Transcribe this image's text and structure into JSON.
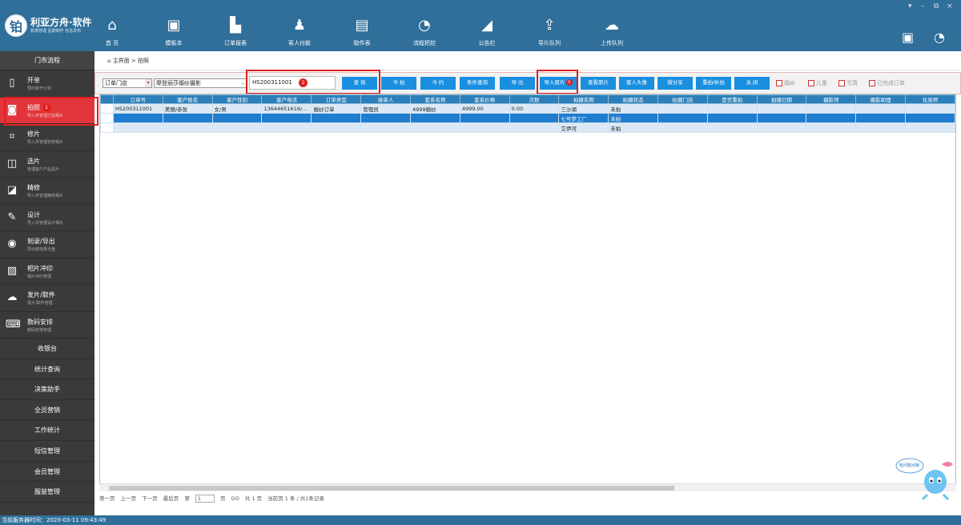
{
  "app": {
    "name": "利亚方舟·软件",
    "slogan": "影楼管理 后期制作 信息发布"
  },
  "topnav": [
    {
      "label": "首 页",
      "icon": "home-icon"
    },
    {
      "label": "模板本",
      "icon": "onenote-icon"
    },
    {
      "label": "订单报表",
      "icon": "bar-chart-icon"
    },
    {
      "label": "客人付款",
      "icon": "users-icon"
    },
    {
      "label": "取件表",
      "icon": "clipboard-icon"
    },
    {
      "label": "流程把控",
      "icon": "signal-icon"
    },
    {
      "label": "公告栏",
      "icon": "megaphone-icon"
    },
    {
      "label": "导片队列",
      "icon": "upload-box-icon"
    },
    {
      "label": "上传队列",
      "icon": "cloud-upload-icon"
    }
  ],
  "sidebar": {
    "header": "门市流程",
    "items": [
      {
        "title": "开单",
        "sub": "预约新开订单",
        "icon": "phone-icon"
      },
      {
        "title": "拍照",
        "sub": "导入并管理已拍相片",
        "icon": "camera-icon",
        "badge": "1"
      },
      {
        "title": "修片",
        "sub": "导入并管理初修相片",
        "icon": "crop-icon"
      },
      {
        "title": "选片",
        "sub": "管理客户产品选片",
        "icon": "image-select-icon"
      },
      {
        "title": "精修",
        "sub": "导入并管理精修相片",
        "icon": "retouch-icon"
      },
      {
        "title": "设计",
        "sub": "导入并管理设计相片",
        "icon": "brush-icon"
      },
      {
        "title": "刻录/导出",
        "sub": "导出和刻录光盘",
        "icon": "disc-icon"
      },
      {
        "title": "相片冲印",
        "sub": "相片冲印管理",
        "icon": "photo-icon"
      },
      {
        "title": "发片/取件",
        "sub": "发片/取件管理",
        "icon": "upload-cloud-icon"
      },
      {
        "title": "数码安排",
        "sub": "数码安排管理",
        "icon": "keyboard-icon"
      }
    ],
    "plain": [
      "收银台",
      "统计查询",
      "决策助手",
      "全员营销",
      "工作统计",
      "短信管理",
      "会员管理",
      "服装管理"
    ]
  },
  "breadcrumb": {
    "home": "主界面",
    "sep": ">",
    "current": "拍照"
  },
  "toolbar": {
    "store_select": "订单门店",
    "package_select": "摩登丽莎婚纱摄影",
    "search_value": "HS200311001",
    "search_badge": "2",
    "buttons": [
      "查 询",
      "今 拍",
      "今 约",
      "条件查询",
      "导 出",
      "导入原片",
      "查看原片",
      "客人头像",
      "微分享",
      "重拍/补拍",
      "关 闭"
    ],
    "import_badge": "3",
    "checkboxes": [
      "婚纱",
      "儿童",
      "写真",
      "已完成订单"
    ]
  },
  "table": {
    "columns": [
      "订单号",
      "客户姓名",
      "客户性别",
      "客户电话",
      "订单类型",
      "接单人",
      "套系名称",
      "套系价格",
      "次数",
      "拍摄名称",
      "拍摄状态",
      "拍摄门店",
      "是否重拍",
      "拍摄日期",
      "摄影师",
      "摄影助理",
      "化妆师"
    ],
    "rows": [
      [
        "HS200311001",
        "美丽/赤张",
        "女/男",
        "13644651616/…",
        "婚纱订单",
        "管理员",
        "4999婚纱",
        "4999.00",
        "0.00",
        "三沙湖",
        "未拍",
        "",
        "",
        "",
        "",
        "",
        ""
      ],
      [
        "",
        "",
        "",
        "",
        "",
        "",
        "",
        "",
        "",
        "七号梦工厂",
        "未拍",
        "",
        "",
        "",
        "",
        "",
        ""
      ],
      [
        "",
        "",
        "",
        "",
        "",
        "",
        "",
        "",
        "",
        "艾伊河",
        "未拍",
        "",
        "",
        "",
        "",
        "",
        ""
      ]
    ]
  },
  "pager": {
    "first": "第一页",
    "prev": "上一页",
    "next": "下一页",
    "last": "最后页",
    "page_prefix": "第",
    "page_value": "1",
    "page_suffix": "页",
    "go": "GO",
    "total_pages": "共 1 页",
    "current": "当前页 1 条 / 共1条记录"
  },
  "status": "当前服务器时间：2020-03-11 09:43:49",
  "mascot": {
    "bubble": "有问题点我"
  },
  "colors": {
    "topbar": "#2f6f9a",
    "sidebar": "#3a3a3a",
    "active": "#e2343b",
    "button": "#1a8fe0",
    "table_header": "#2c7fb8",
    "selected_row": "#1f7ed0"
  }
}
